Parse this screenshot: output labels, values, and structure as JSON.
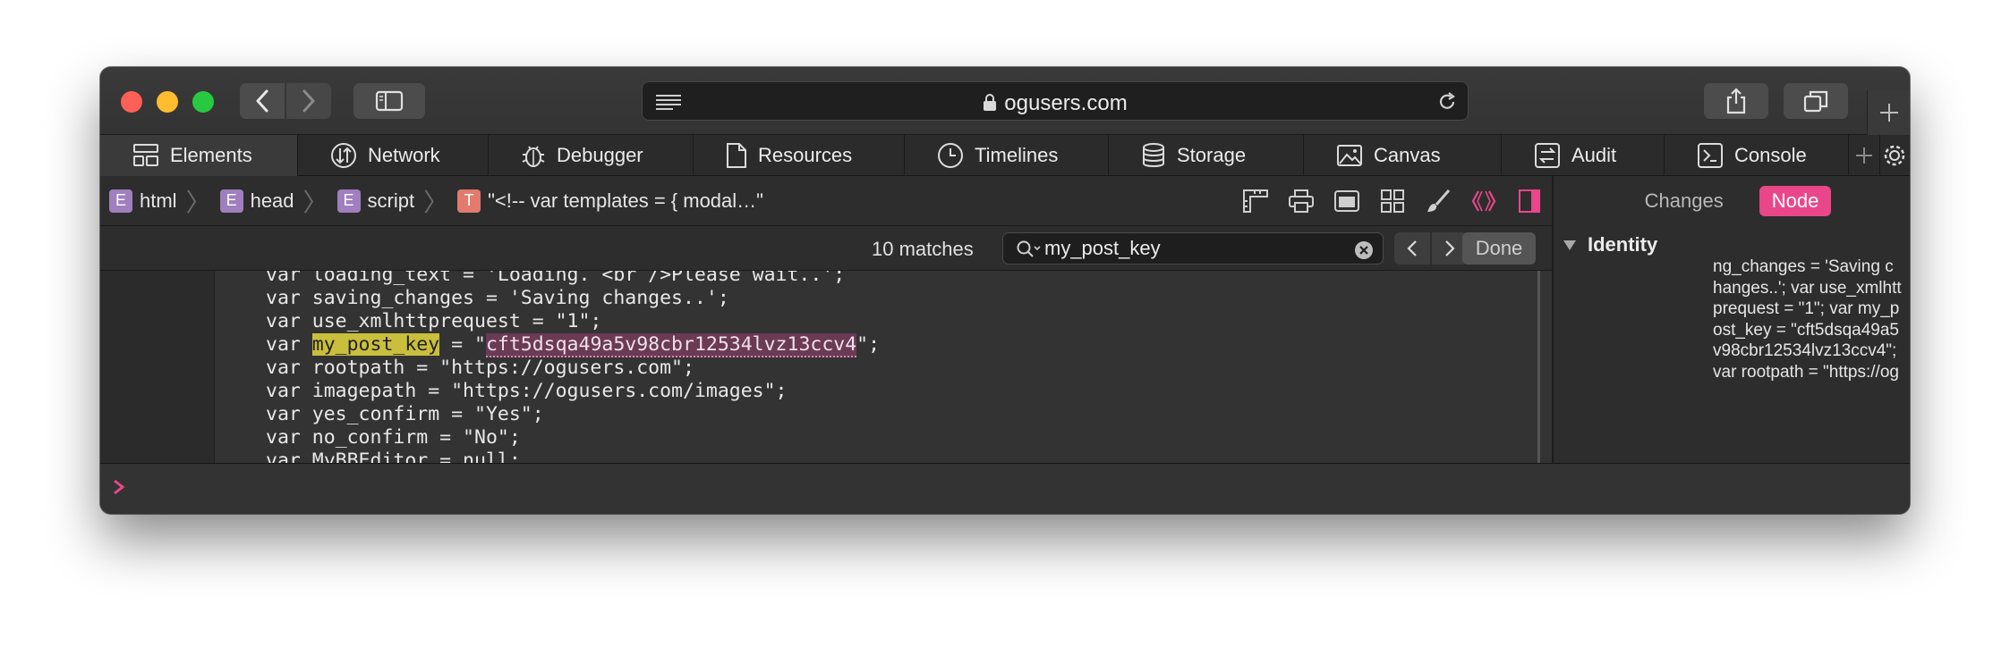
{
  "window": {
    "address": "ogusers.com"
  },
  "tabs": [
    {
      "label": "Elements",
      "icon": "elements-icon"
    },
    {
      "label": "Network",
      "icon": "network-icon"
    },
    {
      "label": "Debugger",
      "icon": "debugger-icon"
    },
    {
      "label": "Resources",
      "icon": "resources-icon"
    },
    {
      "label": "Timelines",
      "icon": "timelines-icon"
    },
    {
      "label": "Storage",
      "icon": "storage-icon"
    },
    {
      "label": "Canvas",
      "icon": "canvas-icon"
    },
    {
      "label": "Audit",
      "icon": "audit-icon"
    },
    {
      "label": "Console",
      "icon": "console-icon"
    }
  ],
  "breadcrumb": [
    {
      "badge": "E",
      "label": "html"
    },
    {
      "badge": "E",
      "label": "head"
    },
    {
      "badge": "E",
      "label": "script"
    },
    {
      "badge": "T",
      "label": "\"<!-- var templates = { modal…\""
    }
  ],
  "find": {
    "matches": "10 matches",
    "query": "my_post_key",
    "done_label": "Done"
  },
  "code": {
    "lines": [
      "var loading_text = 'Loading. <br />Please wait..';",
      "var saving_changes = 'Saving changes..';",
      "var use_xmlhttprequest = \"1\";",
      "var rootpath = \"https://ogusers.com\";",
      "var imagepath = \"https://ogusers.com/images\";",
      "var yes_confirm = \"Yes\";",
      "var no_confirm = \"No\";",
      "var MyBBEditor = null;"
    ],
    "key_line_prefix": "var ",
    "key_name": "my_post_key",
    "key_eq": " = \"",
    "key_value": "cft5dsqa49a5v98cbr12534lvz13ccv4",
    "key_end": "\";"
  },
  "details": {
    "tab_changes": "Changes",
    "tab_node": "Node",
    "section_title": "Identity",
    "node_value": "ng_changes = 'Saving changes..'; var use_xmlhttprequest = \"1\"; var my_post_key = \"cft5dsqa49a5v98cbr12534lvz13ccv4\"; var rootpath = \"https://ogusers.com\"; var imagepath = \"https://ogusers.com/images\"; var"
  },
  "colors": {
    "accent": "#e9478a",
    "highlight_key": "#c9bf3c",
    "highlight_value": "#6b3a55"
  }
}
